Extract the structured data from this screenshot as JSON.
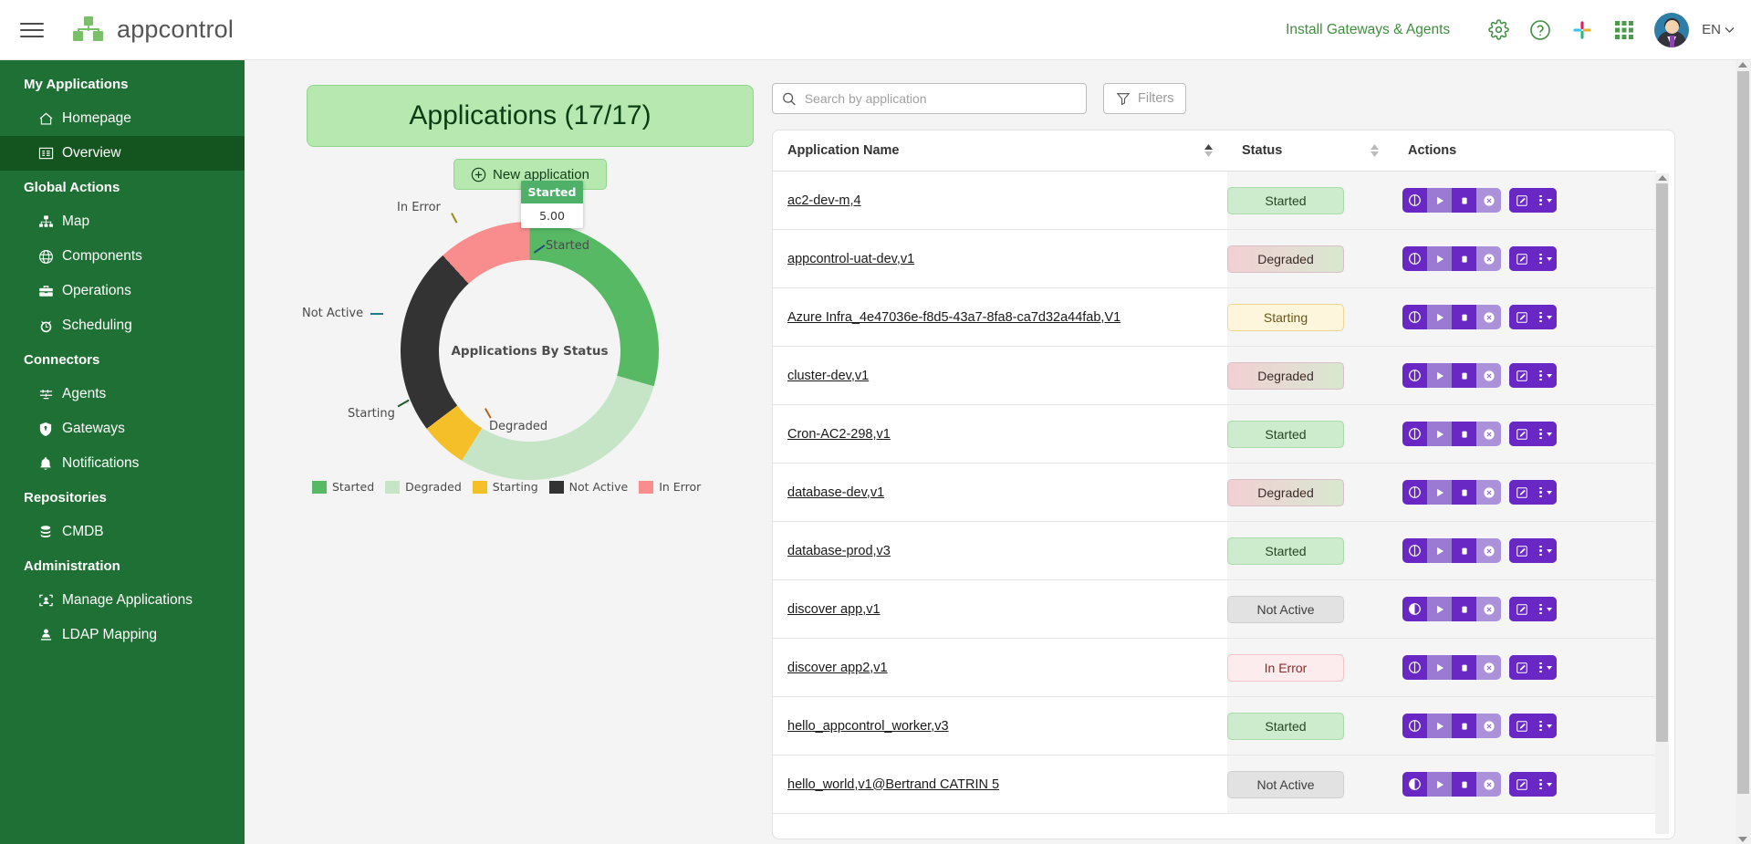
{
  "header": {
    "brand": "appcontrol",
    "install_link": "Install Gateways & Agents",
    "language": "EN",
    "icons": [
      "gear-icon",
      "help-icon",
      "slack-icon",
      "apps-grid-icon",
      "avatar",
      "chevron-down-icon"
    ]
  },
  "sidebar": {
    "groups": [
      {
        "title": "My Applications",
        "items": [
          {
            "label": "Homepage",
            "icon": "home-icon",
            "active": false
          },
          {
            "label": "Overview",
            "icon": "list-icon",
            "active": true
          }
        ]
      },
      {
        "title": "Global Actions",
        "items": [
          {
            "label": "Map",
            "icon": "sitemap-icon",
            "active": false
          },
          {
            "label": "Components",
            "icon": "globe-icon",
            "active": false
          },
          {
            "label": "Operations",
            "icon": "toolbox-icon",
            "active": false
          },
          {
            "label": "Scheduling",
            "icon": "alarm-clock-icon",
            "active": false
          }
        ]
      },
      {
        "title": "Connectors",
        "items": [
          {
            "label": "Agents",
            "icon": "agent-icon",
            "active": false
          },
          {
            "label": "Gateways",
            "icon": "shield-icon",
            "active": false
          },
          {
            "label": "Notifications",
            "icon": "bell-icon",
            "active": false
          }
        ]
      },
      {
        "title": "Repositories",
        "items": [
          {
            "label": "CMDB",
            "icon": "database-icon",
            "active": false
          }
        ]
      },
      {
        "title": "Administration",
        "items": [
          {
            "label": "Manage Applications",
            "icon": "user-frame-icon",
            "active": false
          },
          {
            "label": "LDAP Mapping",
            "icon": "ldap-icon",
            "active": false
          }
        ]
      }
    ]
  },
  "left": {
    "panel_title": "Applications (17/17)",
    "new_app_button": "New application"
  },
  "chart_data": {
    "type": "pie",
    "title": "Applications By Status",
    "categories": [
      "Started",
      "Degraded",
      "Starting",
      "Not Active",
      "In Error"
    ],
    "values": [
      5,
      5,
      1,
      4,
      2
    ],
    "colors": [
      "#57b964",
      "#c6e5c6",
      "#f5bf2a",
      "#333333",
      "#f98d8d"
    ],
    "legend": [
      "Started",
      "Degraded",
      "Starting",
      "Not Active",
      "In Error"
    ],
    "legend_position": "bottom",
    "callouts": [
      "Started",
      "Degraded",
      "Starting",
      "Not Active",
      "In Error"
    ],
    "tooltip": {
      "label": "Started",
      "value": "5.00"
    }
  },
  "search": {
    "placeholder": "Search by application",
    "value": "",
    "filters_label": "Filters"
  },
  "table": {
    "columns": [
      "Application Name",
      "Status",
      "Actions"
    ],
    "rows": [
      {
        "name": "ac2-dev-m,4",
        "status": "Started",
        "status_class": "b-started",
        "power": "off"
      },
      {
        "name": "appcontrol-uat-dev,v1",
        "status": "Degraded",
        "status_class": "b-degraded",
        "power": "off"
      },
      {
        "name": "Azure Infra_4e47036e-f8d5-43a7-8fa8-ca7d32a44fab,V1",
        "status": "Starting",
        "status_class": "b-starting",
        "power": "off"
      },
      {
        "name": "cluster-dev,v1",
        "status": "Degraded",
        "status_class": "b-degraded",
        "power": "off"
      },
      {
        "name": "Cron-AC2-298,v1",
        "status": "Started",
        "status_class": "b-started",
        "power": "off"
      },
      {
        "name": "database-dev,v1",
        "status": "Degraded",
        "status_class": "b-degraded",
        "power": "off"
      },
      {
        "name": "database-prod,v3",
        "status": "Started",
        "status_class": "b-started",
        "power": "off"
      },
      {
        "name": "discover app,v1",
        "status": "Not Active",
        "status_class": "b-notactive",
        "power": "on"
      },
      {
        "name": "discover app2,v1",
        "status": "In Error",
        "status_class": "b-inerror",
        "power": "off"
      },
      {
        "name": "hello_appcontrol_worker,v3",
        "status": "Started",
        "status_class": "b-started",
        "power": "off"
      },
      {
        "name": "hello_world,v1@Bertrand CATRIN 5",
        "status": "Not Active",
        "status_class": "b-notactive",
        "power": "on"
      }
    ],
    "action_icons": [
      "toggle-icon",
      "play-icon",
      "stop-icon",
      "cancel-icon",
      "edit-icon",
      "more-options-icon"
    ]
  }
}
